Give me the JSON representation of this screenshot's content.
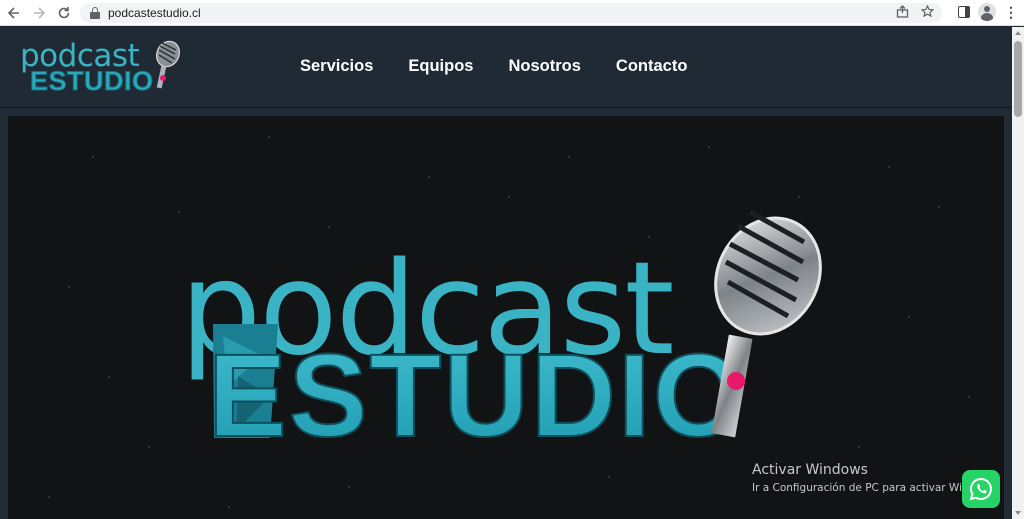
{
  "browser": {
    "url": "podcastestudio.cl",
    "icons": [
      "back-arrow-icon",
      "forward-arrow-icon",
      "reload-icon",
      "lock-icon",
      "share-icon",
      "star-icon",
      "side-panel-icon",
      "profile-icon",
      "menu-icon"
    ]
  },
  "header": {
    "logo_top": "podcast",
    "logo_bottom": "ESTUDIO",
    "nav": [
      "Servicios",
      "Equipos",
      "Nosotros",
      "Contacto"
    ]
  },
  "hero": {
    "logo_top": "podcast",
    "logo_bottom": "ESTUDIO"
  },
  "watermark": {
    "title": "Activar Windows",
    "subtitle": "Ir a Configuración de PC para activar Wind"
  },
  "colors": {
    "header_bg": "#1f2a34",
    "accent_teal": "#2aa9bd",
    "accent_pink": "#e8196b",
    "whatsapp_green": "#25d366"
  }
}
